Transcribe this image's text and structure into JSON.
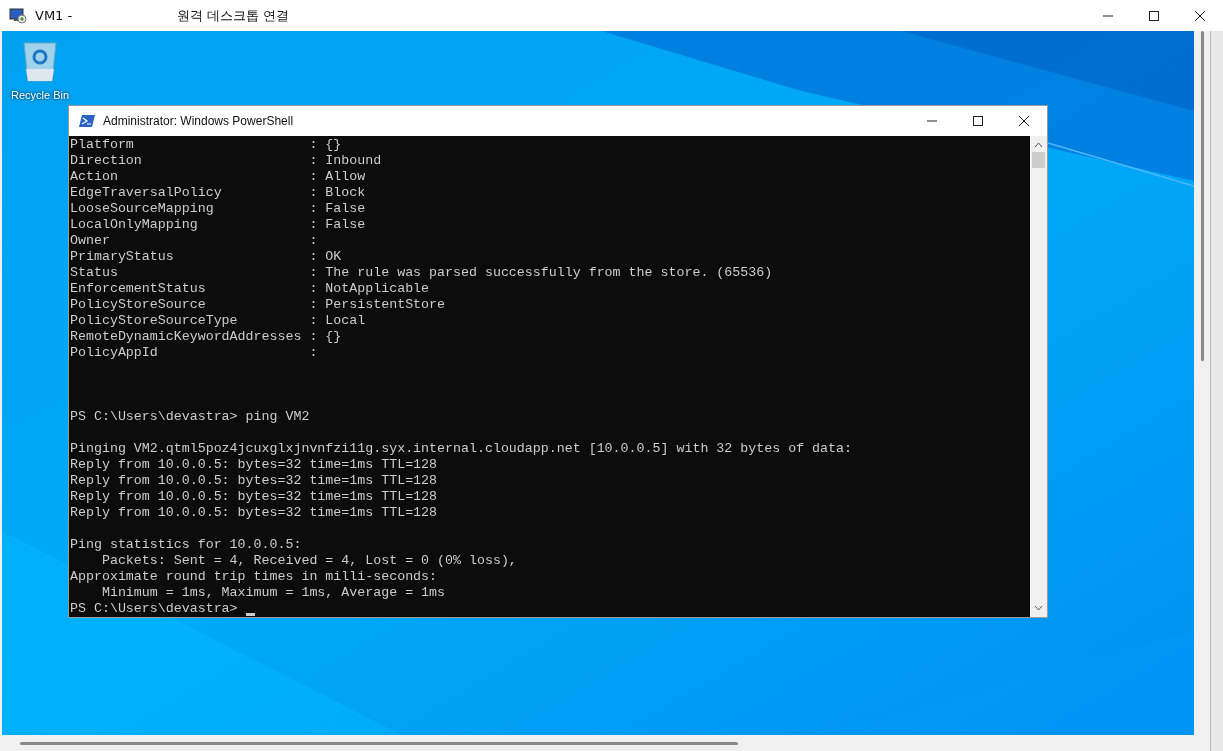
{
  "window": {
    "title": "VM1 -",
    "subtitle": "원격 데스크톱 연결"
  },
  "desktop": {
    "icons": [
      {
        "label": "Recycle Bin"
      }
    ]
  },
  "powershell": {
    "title": "Administrator: Windows PowerShell",
    "lines": [
      {
        "kind": "text",
        "text": "Platform                      : {}"
      },
      {
        "kind": "text",
        "text": "Direction                     : Inbound"
      },
      {
        "kind": "text",
        "text": "Action                        : Allow"
      },
      {
        "kind": "text",
        "text": "EdgeTraversalPolicy           : Block"
      },
      {
        "kind": "text",
        "text": "LooseSourceMapping            : False"
      },
      {
        "kind": "text",
        "text": "LocalOnlyMapping              : False"
      },
      {
        "kind": "text",
        "text": "Owner                         :"
      },
      {
        "kind": "text",
        "text": "PrimaryStatus                 : OK"
      },
      {
        "kind": "text",
        "text": "Status                        : The rule was parsed successfully from the store. (65536)"
      },
      {
        "kind": "text",
        "text": "EnforcementStatus             : NotApplicable"
      },
      {
        "kind": "text",
        "text": "PolicyStoreSource             : PersistentStore"
      },
      {
        "kind": "text",
        "text": "PolicyStoreSourceType         : Local"
      },
      {
        "kind": "text",
        "text": "RemoteDynamicKeywordAddresses : {}"
      },
      {
        "kind": "text",
        "text": "PolicyAppId                   :"
      },
      {
        "kind": "blank"
      },
      {
        "kind": "blank"
      },
      {
        "kind": "blank"
      },
      {
        "kind": "text",
        "text": "PS C:\\Users\\devastra> ping VM2"
      },
      {
        "kind": "blank"
      },
      {
        "kind": "text",
        "text": "Pinging VM2.qtml5poz4jcuxglxjnvnfzi11g.syx.internal.cloudapp.net [10.0.0.5] with 32 bytes of data:"
      },
      {
        "kind": "text",
        "text": "Reply from 10.0.0.5: bytes=32 time=1ms TTL=128"
      },
      {
        "kind": "text",
        "text": "Reply from 10.0.0.5: bytes=32 time=1ms TTL=128"
      },
      {
        "kind": "text",
        "text": "Reply from 10.0.0.5: bytes=32 time=1ms TTL=128"
      },
      {
        "kind": "text",
        "text": "Reply from 10.0.0.5: bytes=32 time=1ms TTL=128"
      },
      {
        "kind": "blank"
      },
      {
        "kind": "text",
        "text": "Ping statistics for 10.0.0.5:"
      },
      {
        "kind": "text",
        "text": "    Packets: Sent = 4, Received = 4, Lost = 0 (0% loss),"
      },
      {
        "kind": "text",
        "text": "Approximate round trip times in milli-seconds:"
      },
      {
        "kind": "text",
        "text": "    Minimum = 1ms, Maximum = 1ms, Average = 1ms"
      },
      {
        "kind": "prompt",
        "text": "PS C:\\Users\\devastra> "
      }
    ]
  }
}
